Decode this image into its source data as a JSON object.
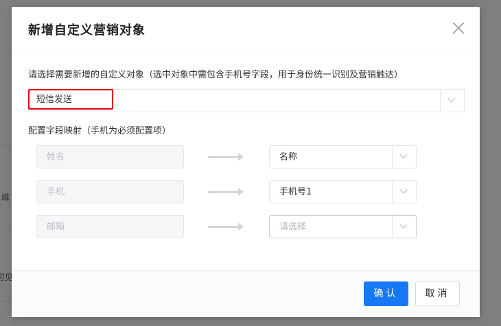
{
  "background": {
    "partial_text_1": "维",
    "partial_text_2": "可见"
  },
  "dialog": {
    "title": "新增自定义营销对象",
    "instruction": "请选择需要新增的自定义对象（选中对象中需包含手机号字段，用于身份统一识别及营销触达）",
    "object_select": {
      "value": "短信发送"
    },
    "mapping_label": "配置字段映射（手机为必须配置项）",
    "mappings": [
      {
        "source": "姓名",
        "target": "名称",
        "target_is_placeholder": false
      },
      {
        "source": "手机",
        "target": "手机号1",
        "target_is_placeholder": false
      },
      {
        "source": "邮箱",
        "target": "请选择",
        "target_is_placeholder": true
      }
    ],
    "confirm_label": "确认",
    "cancel_label": "取消"
  },
  "colors": {
    "primary": "#1678f5",
    "highlight_border": "#e60012"
  }
}
